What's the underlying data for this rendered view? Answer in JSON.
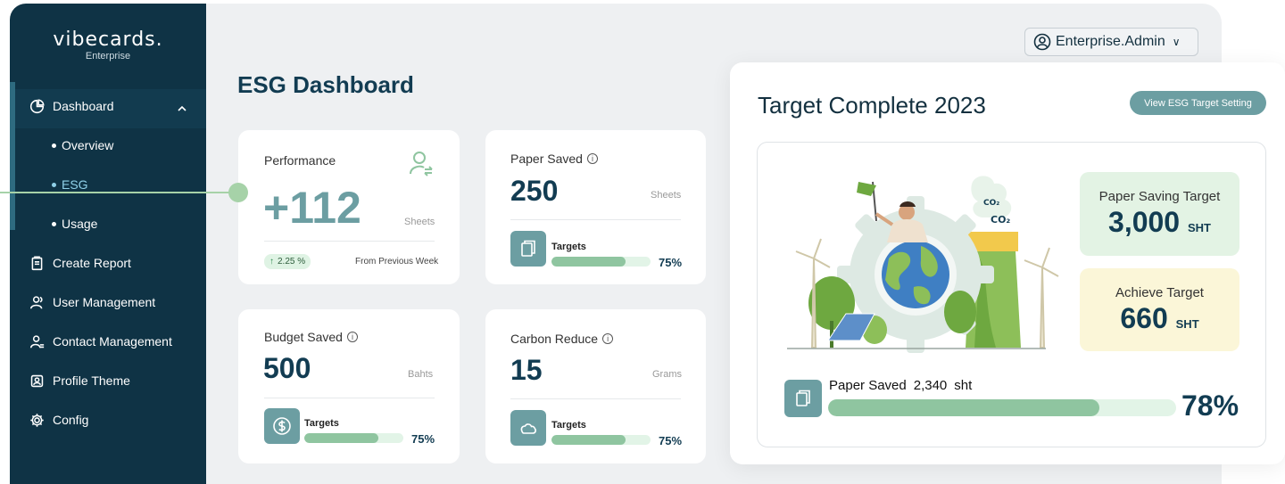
{
  "brand": {
    "name": "vibecards.",
    "edition": "Enterprise"
  },
  "sidebar": {
    "items": [
      {
        "label": "Dashboard"
      },
      {
        "label": "Overview"
      },
      {
        "label": "ESG"
      },
      {
        "label": "Usage"
      },
      {
        "label": "Create Report"
      },
      {
        "label": "User Management"
      },
      {
        "label": "Contact Management"
      },
      {
        "label": "Profile Theme"
      },
      {
        "label": "Config"
      }
    ]
  },
  "header": {
    "user": "Enterprise.Admin"
  },
  "page": {
    "title": "ESG Dashboard"
  },
  "cards": {
    "performance": {
      "label": "Performance",
      "value": "+112",
      "unit": "Sheets",
      "change": "2.25 %",
      "change_note": "From Previous Week"
    },
    "paper": {
      "label": "Paper Saved",
      "value": "250",
      "unit": "Sheets",
      "target_label": "Targets",
      "pct": "75%",
      "progress": 0.75
    },
    "budget": {
      "label": "Budget Saved",
      "value": "500",
      "unit": "Bahts",
      "target_label": "Targets",
      "pct": "75%",
      "progress": 0.75
    },
    "carbon": {
      "label": "Carbon Reduce",
      "value": "15",
      "unit": "Grams",
      "target_label": "Targets",
      "pct": "75%",
      "progress": 0.75
    }
  },
  "target_panel": {
    "title": "Target Complete 2023",
    "view_button": "View ESG Target Setting",
    "paper_target_label": "Paper Saving Target",
    "paper_target_value": "3,000",
    "paper_target_unit": "SHT",
    "achieve_label": "Achieve Target",
    "achieve_value": "660",
    "achieve_unit": "SHT",
    "paper_saved_label": "Paper Saved",
    "paper_saved_value": "2,340",
    "paper_saved_unit": "sht",
    "paper_saved_pct": "78%",
    "progress": 0.78,
    "illustration_co2_big": "CO₂",
    "illustration_co2_small": "CO₂"
  },
  "colors": {
    "sidebar": "#0f3345",
    "accent": "#6c9ea2",
    "bar": "#8fc5a0",
    "track": "#e2f4e7",
    "title": "#123c52"
  }
}
